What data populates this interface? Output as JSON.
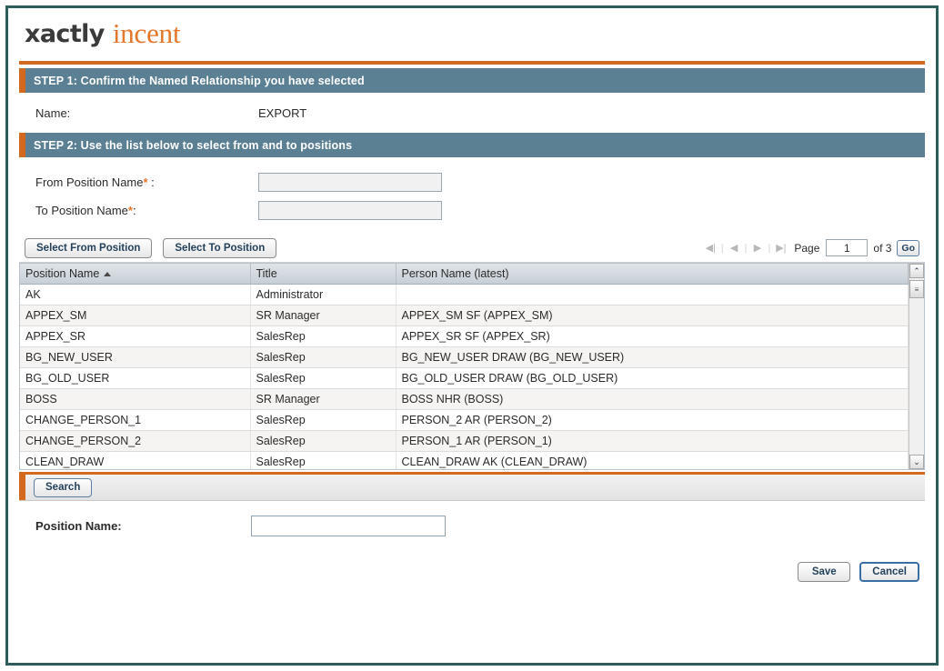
{
  "brand": {
    "name_primary": "xactly",
    "name_secondary": "incent"
  },
  "step1": {
    "header": "STEP 1: Confirm the Named Relationship you have selected",
    "name_label": "Name:",
    "name_value": "EXPORT"
  },
  "step2": {
    "header": "STEP 2: Use the list below to select from and to positions",
    "from_label": "From Position Name",
    "from_required": "*",
    "from_suffix": " :",
    "from_value": "",
    "to_label": "To Position Name",
    "to_required": "*",
    "to_suffix": ":",
    "to_value": "",
    "select_from_button": "Select From Position",
    "select_to_button": "Select To Position"
  },
  "pager": {
    "first_icon": "◀|",
    "prev_icon": "◀",
    "next_icon": "▶",
    "last_icon": "▶|",
    "page_label": "Page",
    "page_value": "1",
    "of_label": "of 3",
    "go_label": "Go"
  },
  "grid": {
    "columns": [
      "Position Name",
      "Title",
      "Person Name (latest)"
    ],
    "sort_column": "Position Name",
    "sort_direction": "ascending",
    "rows": [
      {
        "position": "AK",
        "title": "Administrator",
        "person": ""
      },
      {
        "position": "APPEX_SM",
        "title": "SR Manager",
        "person": "APPEX_SM SF (APPEX_SM)"
      },
      {
        "position": "APPEX_SR",
        "title": "SalesRep",
        "person": "APPEX_SR SF (APPEX_SR)"
      },
      {
        "position": "BG_NEW_USER",
        "title": "SalesRep",
        "person": "BG_NEW_USER DRAW (BG_NEW_USER)"
      },
      {
        "position": "BG_OLD_USER",
        "title": "SalesRep",
        "person": "BG_OLD_USER DRAW (BG_OLD_USER)"
      },
      {
        "position": "BOSS",
        "title": "SR Manager",
        "person": "BOSS NHR (BOSS)"
      },
      {
        "position": "CHANGE_PERSON_1",
        "title": "SalesRep",
        "person": "PERSON_2 AR (PERSON_2)"
      },
      {
        "position": "CHANGE_PERSON_2",
        "title": "SalesRep",
        "person": "PERSON_1 AR (PERSON_1)"
      },
      {
        "position": "CLEAN_DRAW",
        "title": "SalesRep",
        "person": "CLEAN_DRAW AK (CLEAN_DRAW)"
      }
    ],
    "scroll_up_icon": "⌃",
    "scroll_down_icon": "⌄",
    "scroll_thumb_icon": "≡"
  },
  "search": {
    "tab_label": "Search",
    "position_name_label": "Position Name:",
    "position_name_value": "",
    "position_name_placeholder": ""
  },
  "footer": {
    "save_label": "Save",
    "cancel_label": "Cancel"
  },
  "colors": {
    "frame": "#2d5d59",
    "accent_orange": "#d2691e",
    "step_header": "#5b7f93",
    "brand_orange": "#e3762a"
  }
}
